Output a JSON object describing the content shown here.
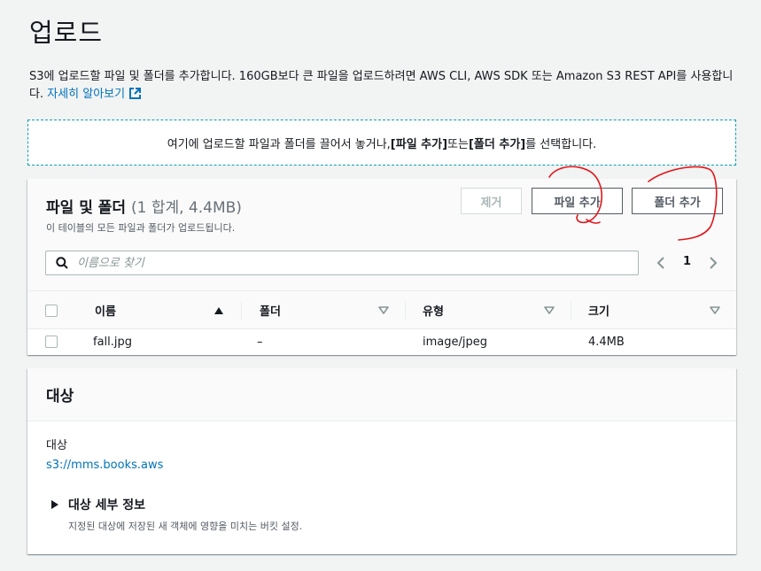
{
  "page": {
    "title": "업로드",
    "description": "S3에 업로드할 파일 및 폴더를 추가합니다. 160GB보다 큰 파일을 업로드하려면 AWS CLI, AWS SDK 또는 Amazon S3 REST API를 사용합니다.",
    "learn_more": "자세히 알아보기"
  },
  "dropzone": {
    "prefix": "여기에 업로드할 파일과 폴더를 끌어서 놓거나, ",
    "add_files": "[파일 추가]",
    "middle": " 또는 ",
    "add_folder": "[폴더 추가]",
    "suffix": "를 선택합니다."
  },
  "files_panel": {
    "title": "파일 및 폴더",
    "count": "(1 합계, 4.4MB)",
    "subtitle": "이 테이블의 모든 파일과 폴더가 업로드됩니다.",
    "remove_label": "제거",
    "add_files_label": "파일 추가",
    "add_folder_label": "폴더 추가",
    "search_placeholder": "이름으로 찾기",
    "page_number": "1",
    "columns": [
      "이름",
      "폴더",
      "유형",
      "크기"
    ],
    "rows": [
      {
        "name": "fall.jpg",
        "folder": "–",
        "type": "image/jpeg",
        "size": "4.4MB"
      }
    ]
  },
  "destination_panel": {
    "title": "대상",
    "label": "대상",
    "link": "s3://mms.books.aws",
    "details_title": "대상 세부 정보",
    "details_sub": "지정된 대상에 저장된 새 객체에 영향을 미치는 버킷 설정."
  },
  "colors": {
    "link": "#0073bb",
    "annotation": "#e0161a",
    "dropzone_border": "#0aa1b5"
  }
}
